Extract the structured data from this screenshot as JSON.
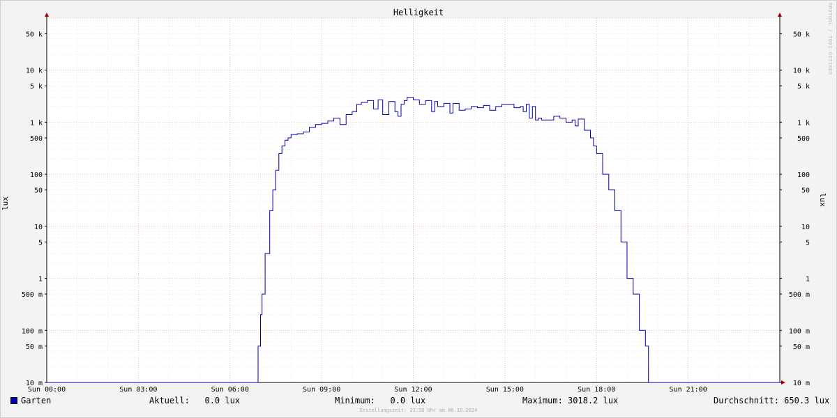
{
  "chart_data": {
    "type": "line",
    "title": "Helligkeit",
    "ylabel": "lux",
    "yscale": "log",
    "ylim": [
      0.01,
      100000
    ],
    "xlim": [
      0,
      24
    ],
    "x_ticks": [
      "Sun 00:00",
      "Sun 03:00",
      "Sun 06:00",
      "Sun 09:00",
      "Sun 12:00",
      "Sun 15:00",
      "Sun 18:00",
      "Sun 21:00"
    ],
    "y_ticks": [
      {
        "value": 50000,
        "label": "50 k"
      },
      {
        "value": 10000,
        "label": "10 k"
      },
      {
        "value": 5000,
        "label": "5 k"
      },
      {
        "value": 1000,
        "label": "1 k"
      },
      {
        "value": 500,
        "label": "500"
      },
      {
        "value": 100,
        "label": "100"
      },
      {
        "value": 50,
        "label": "50"
      },
      {
        "value": 10,
        "label": "10"
      },
      {
        "value": 5,
        "label": "5"
      },
      {
        "value": 1,
        "label": "1"
      },
      {
        "value": 0.5,
        "label": "500 m"
      },
      {
        "value": 0.1,
        "label": "100 m"
      },
      {
        "value": 0.05,
        "label": "50 m"
      },
      {
        "value": 0.01,
        "label": "10 m"
      }
    ],
    "grid": true,
    "series": [
      {
        "name": "Garten",
        "color": "#0000b0",
        "x": [
          0,
          6.9,
          6.92,
          7.0,
          7.05,
          7.15,
          7.3,
          7.4,
          7.5,
          7.6,
          7.7,
          7.8,
          7.9,
          8.0,
          8.2,
          8.4,
          8.6,
          8.8,
          9.0,
          9.2,
          9.4,
          9.6,
          9.8,
          10.0,
          10.15,
          10.3,
          10.5,
          10.7,
          10.85,
          11.0,
          11.2,
          11.4,
          11.5,
          11.6,
          11.7,
          11.8,
          12.0,
          12.2,
          12.4,
          12.6,
          12.7,
          12.8,
          13.0,
          13.2,
          13.3,
          13.5,
          13.7,
          13.9,
          14.1,
          14.3,
          14.5,
          14.7,
          14.9,
          15.1,
          15.3,
          15.5,
          15.6,
          15.7,
          15.8,
          15.9,
          16.0,
          16.1,
          16.2,
          16.4,
          16.6,
          16.8,
          17.0,
          17.2,
          17.3,
          17.4,
          17.6,
          17.8,
          17.9,
          18.0,
          18.2,
          18.4,
          18.6,
          18.8,
          19.0,
          19.2,
          19.4,
          19.6,
          19.7,
          19.75,
          19.8,
          24
        ],
        "y": [
          0.01,
          0.01,
          0.05,
          0.2,
          0.5,
          3,
          20,
          50,
          120,
          250,
          350,
          450,
          500,
          580,
          600,
          650,
          800,
          900,
          950,
          1050,
          1200,
          900,
          1400,
          1600,
          2200,
          2400,
          2600,
          1800,
          2700,
          1400,
          2500,
          1600,
          1300,
          2200,
          2600,
          3018,
          2700,
          2200,
          2600,
          1600,
          2500,
          2000,
          2300,
          1500,
          2300,
          1700,
          1800,
          2000,
          1900,
          2100,
          1700,
          2000,
          2200,
          2200,
          1900,
          2000,
          1600,
          2200,
          1200,
          2000,
          1100,
          1200,
          1100,
          1100,
          1300,
          1200,
          1000,
          1100,
          850,
          1150,
          700,
          500,
          350,
          250,
          100,
          50,
          20,
          5,
          1,
          0.5,
          0.1,
          0.05,
          0.01,
          0.01,
          0.01,
          0.01
        ]
      }
    ]
  },
  "legend": {
    "name": "Garten",
    "current": "Aktuell:   0.0 lux",
    "minimum": "Minimum:   0.0 lux",
    "maximum": "Maximum: 3018.2 lux",
    "average": "Durchschnitt: 650.3 lux"
  },
  "watermark": "RRDTOOL / TOBI OETIKER",
  "footer": "Erstellungszeit: 23:58 Uhr am 06.10.2024"
}
